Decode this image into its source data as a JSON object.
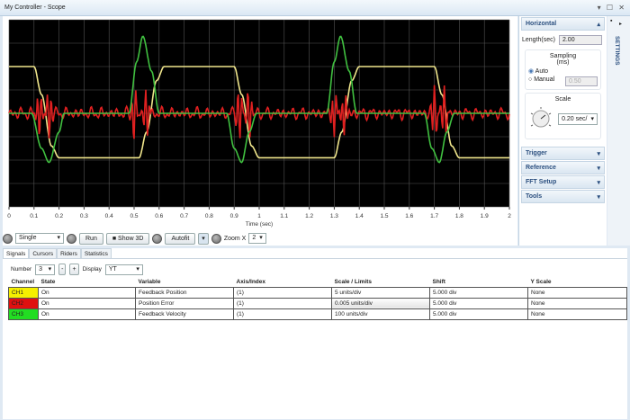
{
  "window": {
    "title": "My Controller - Scope",
    "controls": "▾ ☐ ✕"
  },
  "chart_data": {
    "type": "line",
    "xlabel": "Time (sec)",
    "ylabel": "",
    "xlim": [
      0,
      2
    ],
    "ylim": [
      -4,
      4
    ],
    "grid": true,
    "xticks": [
      "0",
      "0.1",
      "0.2",
      "0.3",
      "0.4",
      "0.5",
      "0.6",
      "0.7",
      "0.8",
      "0.9",
      "1",
      "1.1",
      "1.2",
      "1.3",
      "1.4",
      "1.5",
      "1.6",
      "1.7",
      "1.8",
      "1.9",
      "2"
    ],
    "series": [
      {
        "name": "CH1 Feedback Position",
        "color": "#f0e68c",
        "x": [
          0,
          0.1,
          0.13,
          0.17,
          0.2,
          0.52,
          0.55,
          0.59,
          0.62,
          0.9,
          0.93,
          0.97,
          1.0,
          1.3,
          1.33,
          1.37,
          1.4,
          1.7,
          1.73,
          1.77,
          1.8,
          2.0
        ],
        "y": [
          2,
          2,
          0.8,
          -1.4,
          -1.9,
          -1.9,
          -0.8,
          1.4,
          2,
          2,
          0.8,
          -1.4,
          -1.9,
          -1.9,
          -0.8,
          1.4,
          2,
          2,
          0.8,
          -1.4,
          -1.9,
          -1.9
        ]
      },
      {
        "name": "CH2 Position Error",
        "color": "#e02020",
        "x": [
          0,
          0.5,
          1,
          1.5,
          2
        ],
        "y": [
          0,
          0,
          0,
          0,
          0
        ]
      },
      {
        "name": "CH3 Feedback Velocity",
        "color": "#40c040",
        "x": [
          0,
          0.09,
          0.13,
          0.16,
          0.2,
          0.22,
          0.48,
          0.51,
          0.535,
          0.57,
          0.6,
          0.87,
          0.9,
          0.93,
          0.96,
          0.99,
          1.27,
          1.3,
          1.325,
          1.36,
          1.39,
          1.66,
          1.69,
          1.72,
          1.75,
          1.78,
          2.0
        ],
        "y": [
          0,
          0,
          -1.5,
          -2.1,
          -0.8,
          0,
          0,
          2.2,
          3.3,
          1.8,
          0,
          0,
          -1.5,
          -2.1,
          -0.8,
          0,
          0,
          2.2,
          3.3,
          1.8,
          0,
          0,
          -1.5,
          -2.1,
          -0.8,
          0,
          0
        ]
      }
    ]
  },
  "toolbar": {
    "mode": "Single",
    "run": "Run",
    "show3d": "Show 3D",
    "autofit": "Autofit",
    "zoom_label": "Zoom X",
    "zoom_value": "2"
  },
  "settings": {
    "rail_label": "SETTINGS",
    "horizontal": "Horizontal",
    "length_label": "Length(sec)",
    "length_value": "2.00",
    "sampling_label": "Sampling",
    "sampling_unit": "(ms)",
    "auto": "Auto",
    "manual": "Manual",
    "manual_value": "0.50",
    "scale_label": "Scale",
    "scale_value": "0.20 sec/",
    "sections": [
      "Trigger",
      "Reference",
      "FFT Setup",
      "Tools"
    ]
  },
  "bottom": {
    "tabs": [
      "Signals",
      "Cursors",
      "Riders",
      "Statistics"
    ],
    "number_label": "Number",
    "number_value": "3",
    "minus": "-",
    "plus": "+",
    "display_label": "Display",
    "display_value": "YT",
    "headers": [
      "Channel",
      "State",
      "Variable",
      "Axis/Index",
      "Scale / Limits",
      "Shift",
      "Y Scale"
    ],
    "rows": [
      {
        "ch": "CH1",
        "color": "#f5f000",
        "state": "On",
        "var": "Feedback Position",
        "axis": "(1)",
        "scale": "5 units/div",
        "shift": "5.000 div",
        "yscale": "None"
      },
      {
        "ch": "CH2",
        "color": "#e01010",
        "state": "On",
        "var": "Position Error",
        "axis": "(1)",
        "scale": "0.005 units/div",
        "shift": "5.000 div",
        "yscale": "None"
      },
      {
        "ch": "CH3",
        "color": "#22dd22",
        "state": "On",
        "var": "Feedback Velocity",
        "axis": "(1)",
        "scale": "100 units/div",
        "shift": "5.000 div",
        "yscale": "None"
      }
    ]
  }
}
